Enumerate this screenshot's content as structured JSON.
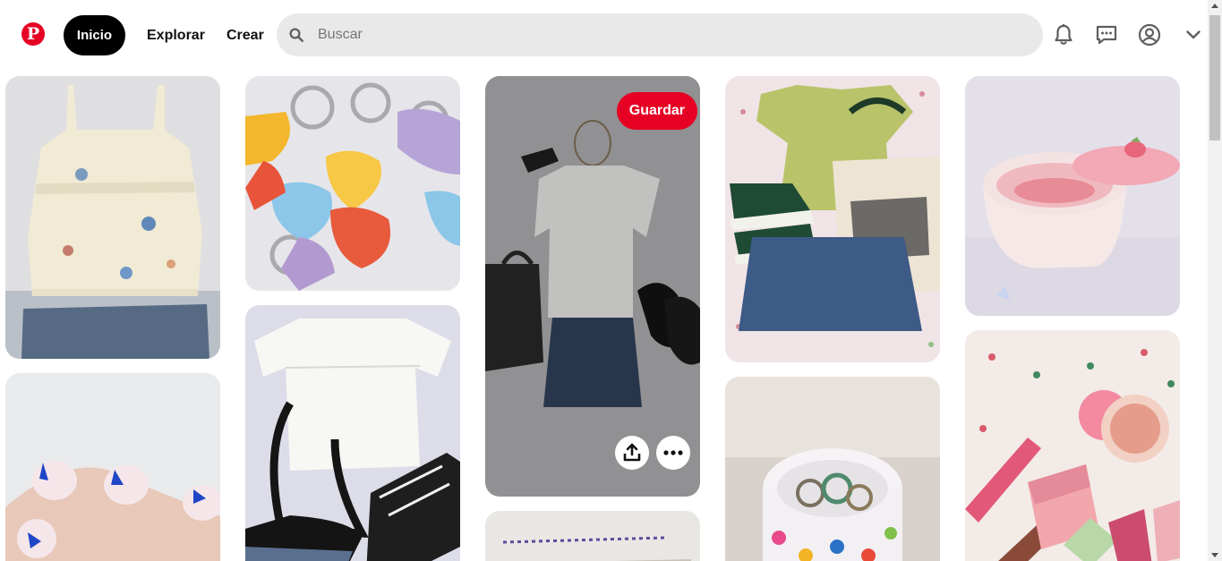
{
  "header": {
    "logo_label": "P",
    "nav_home": "Inicio",
    "nav_explore": "Explorar",
    "nav_create": "Crear",
    "search_placeholder": "Buscar",
    "search_value": ""
  },
  "icons": {
    "logo": "pinterest-logo-icon",
    "search": "search-icon",
    "notifications": "bell-icon",
    "messages": "chat-bubble-icon",
    "profile": "user-circle-icon",
    "account_menu": "chevron-down-icon",
    "share": "share-upload-icon",
    "more": "ellipsis-icon"
  },
  "colors": {
    "brand": "#e60023",
    "active_nav": "#000000",
    "search_bg": "#e9e9e9"
  },
  "pins": [
    {
      "id": "top-cream",
      "subject": "cream top with jeans"
    },
    {
      "id": "nails-blue",
      "subject": "blue flower nails"
    },
    {
      "id": "heart-keychains",
      "subject": "candy heart keychains"
    },
    {
      "id": "white-blouse",
      "subject": "white blouse outfit"
    },
    {
      "id": "grey-tee-outfit",
      "subject": "grey tee and denim skirt",
      "save_label": "Guardar"
    },
    {
      "id": "embroidery",
      "subject": "embroidered fabric"
    },
    {
      "id": "green-top-outfit",
      "subject": "green top outfit with tote"
    },
    {
      "id": "clay-dish",
      "subject": "floral clay ring dish"
    },
    {
      "id": "clay-jar",
      "subject": "pink clay jar"
    },
    {
      "id": "makeup",
      "subject": "makeup products"
    }
  ]
}
